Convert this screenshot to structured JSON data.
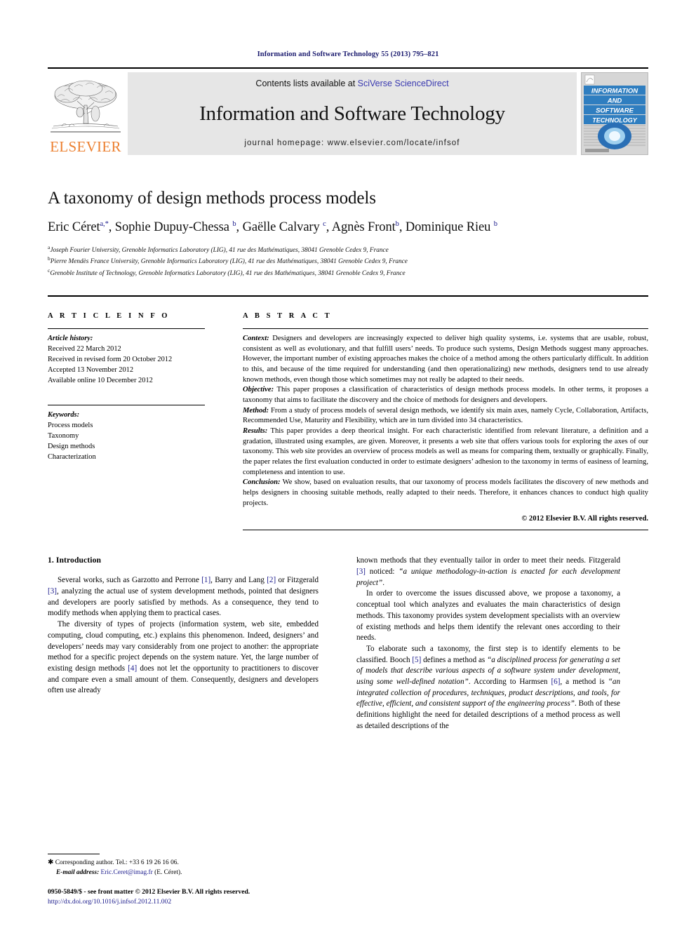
{
  "running_head": "Information and Software Technology 55 (2013) 795–821",
  "masthead": {
    "publisher_logo_label": "ELSEVIER",
    "contents_prefix": "Contents lists available at ",
    "contents_link": "SciVerse ScienceDirect",
    "journal_name": "Information and Software Technology",
    "homepage_label": "journal homepage: www.elsevier.com/locate/infsof",
    "cover": {
      "line1": "INFORMATION",
      "line2": "AND",
      "line3": "SOFTWARE",
      "line4": "TECHNOLOGY"
    }
  },
  "article": {
    "title": "A taxonomy of design methods process models",
    "authors_html": "Eric Céret<sup>a,*</sup>, Sophie Dupuy-Chessa <sup>b</sup>, Gaëlle Calvary <sup>c</sup>, Agnès Front<sup>b</sup>, Dominique Rieu <sup>b</sup>",
    "affiliations": [
      {
        "marker": "a",
        "text": "Joseph Fourier University, Grenoble Informatics Laboratory (LIG), 41 rue des Mathématiques, 38041 Grenoble Cedex 9, France"
      },
      {
        "marker": "b",
        "text": "Pierre Mendès France University, Grenoble Informatics Laboratory (LIG), 41 rue des Mathématiques, 38041 Grenoble Cedex 9, France"
      },
      {
        "marker": "c",
        "text": "Grenoble Institute of Technology, Grenoble Informatics Laboratory (LIG), 41 rue des Mathématiques, 38041 Grenoble Cedex 9, France"
      }
    ]
  },
  "article_info": {
    "heading": "A R T I C L E   I N F O",
    "history_label": "Article history:",
    "history": [
      "Received 22 March 2012",
      "Received in revised form 20 October 2012",
      "Accepted 13 November 2012",
      "Available online 10 December 2012"
    ],
    "keywords_label": "Keywords:",
    "keywords": [
      "Process models",
      "Taxonomy",
      "Design methods",
      "Characterization"
    ]
  },
  "abstract": {
    "heading": "A B S T R A C T",
    "sections": [
      {
        "label": "Context:",
        "text": " Designers and developers are increasingly expected to deliver high quality systems, i.e. systems that are usable, robust, consistent as well as evolutionary, and that fulfill users’ needs. To produce such systems, Design Methods suggest many approaches. However, the important number of existing approaches makes the choice of a method among the others particularly difficult. In addition to this, and because of the time required for understanding (and then operationalizing) new methods, designers tend to use already known methods, even though those which sometimes may not really be adapted to their needs."
      },
      {
        "label": "Objective:",
        "text": " This paper proposes a classification of characteristics of design methods process models. In other terms, it proposes a taxonomy that aims to facilitate the discovery and the choice of methods for designers and developers."
      },
      {
        "label": "Method:",
        "text": " From a study of process models of several design methods, we identify six main axes, namely Cycle, Collaboration, Artifacts, Recommended Use, Maturity and Flexibility, which are in turn divided into 34 characteristics."
      },
      {
        "label": "Results:",
        "text": " This paper provides a deep theorical insight. For each characteristic identified from relevant literature, a definition and a gradation, illustrated using examples, are given. Moreover, it presents a web site that offers various tools for exploring the axes of our taxonomy. This web site provides an overview of process models as well as means for comparing them, textually or graphically. Finally, the paper relates the first evaluation conducted in order to estimate designers’ adhesion to the taxonomy in terms of easiness of learning, completeness and intention to use."
      },
      {
        "label": "Conclusion:",
        "text": " We show, based on evaluation results, that our taxonomy of process models facilitates the discovery of new methods and helps designers in choosing suitable methods, really adapted to their needs. Therefore, it enhances chances to conduct high quality projects."
      }
    ],
    "copyright": "© 2012 Elsevier B.V. All rights reserved."
  },
  "introduction": {
    "heading": "1. Introduction",
    "left_paragraphs": [
      "Several works, such as Garzotto and Perrone [1], Barry and Lang [2] or Fitzgerald [3], analyzing the actual use of system development methods, pointed that designers and developers are poorly satisfied by methods. As a consequence, they tend to modify methods when applying them to practical cases.",
      "The diversity of types of projects (information system, web site, embedded computing, cloud computing, etc.) explains this phenomenon. Indeed, designers’ and developers’ needs may vary considerably from one project to another: the appropriate method for a specific project depends on the system nature. Yet, the large number of existing design methods [4] does not let the opportunity to practitioners to discover and compare even a small amount of them. Consequently, designers and developers often use already"
    ],
    "right_paragraphs": [
      "known methods that they eventually tailor in order to meet their needs. Fitzgerald [3] noticed: “a unique methodology-in-action is enacted for each development project”.",
      "In order to overcome the issues discussed above, we propose a taxonomy, a conceptual tool which analyzes and evaluates the main characteristics of design methods. This taxonomy provides system development specialists with an overview of existing methods and helps them identify the relevant ones according to their needs.",
      "To elaborate such a taxonomy, the first step is to identify elements to be classified. Booch [5] defines a method as “a disciplined process for generating a set of models that describe various aspects of a software system under development, using some well-defined notation”. According to Harmsen [6], a method is “an integrated collection of procedures, techniques, product descriptions, and tools, for effective, efficient, and consistent support of the engineering process”. Both of these definitions highlight the need for detailed descriptions of a method process as well as detailed descriptions of the"
    ]
  },
  "footnote": {
    "corresponding": "Corresponding author. Tel.: +33 6 19 26 16 06.",
    "email_label": "E-mail address:",
    "email": "Eric.Ceret@imag.fr",
    "email_suffix": " (E. Céret)."
  },
  "footer": {
    "issn_line": "0950-5849/$ - see front matter © 2012 Elsevier B.V. All rights reserved.",
    "doi_line": "http://dx.doi.org/10.1016/j.infsof.2012.11.002"
  },
  "colors": {
    "link": "#1a1a8c",
    "elsevier_orange": "#ec8031",
    "masthead_bg": "#e6e6e6",
    "cover_blue": "#2a6fb5"
  }
}
